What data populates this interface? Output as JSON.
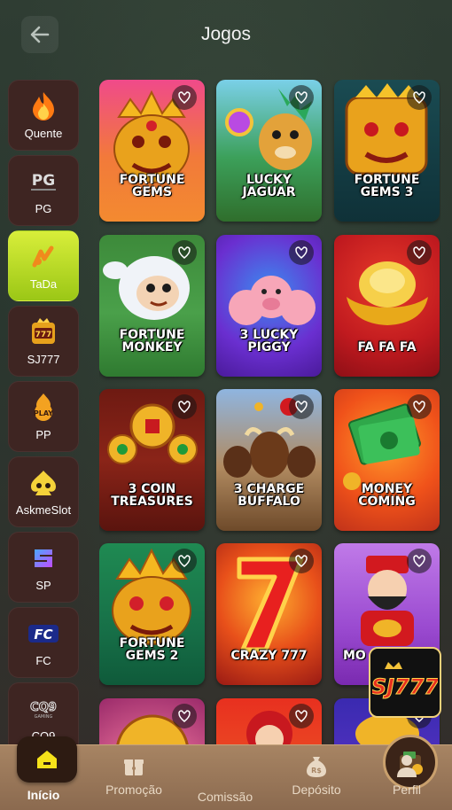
{
  "header": {
    "title": "Jogos"
  },
  "sidebar": {
    "items": [
      {
        "label": "Quente",
        "icon": "fire-icon"
      },
      {
        "label": "PG",
        "icon": "pg-logo-icon"
      },
      {
        "label": "TaDa",
        "icon": "tada-logo-icon",
        "active": true
      },
      {
        "label": "SJ777",
        "icon": "sj777-logo-icon"
      },
      {
        "label": "PP",
        "icon": "pp-logo-icon"
      },
      {
        "label": "AskmeSlot",
        "icon": "askmeslot-logo-icon"
      },
      {
        "label": "SP",
        "icon": "sp-logo-icon"
      },
      {
        "label": "FC",
        "icon": "fc-logo-icon"
      },
      {
        "label": "CQ9",
        "icon": "cq9-logo-icon"
      }
    ]
  },
  "games": [
    {
      "title": "FORTUNE\nGEMS"
    },
    {
      "title": "LUCKY\nJAGUAR"
    },
    {
      "title": "FORTUNE\nGEMS 3"
    },
    {
      "title": "FORTUNE\nMONKEY"
    },
    {
      "title": "3 LUCKY\nPIGGY"
    },
    {
      "title": "FA FA FA"
    },
    {
      "title": "3 COIN\nTREASURES"
    },
    {
      "title": "3 CHARGE\nBUFFALO"
    },
    {
      "title": "MONEY\nCOMING"
    },
    {
      "title": "FORTUNE\nGEMS 2"
    },
    {
      "title": "CRAZY 777"
    },
    {
      "title": "MO"
    },
    {
      "title": ""
    },
    {
      "title": ""
    },
    {
      "title": ""
    }
  ],
  "bottom_nav": {
    "items": [
      {
        "label": "Início",
        "icon": "home-icon",
        "active": true
      },
      {
        "label": "Promoção",
        "icon": "gift-icon"
      },
      {
        "label": "Comissão",
        "icon": "wallet-icon"
      },
      {
        "label": "Depósito",
        "icon": "money-bag-icon"
      },
      {
        "label": "Perfil",
        "icon": "user-icon"
      }
    ]
  },
  "floating_badge": {
    "text": "SJ777"
  }
}
